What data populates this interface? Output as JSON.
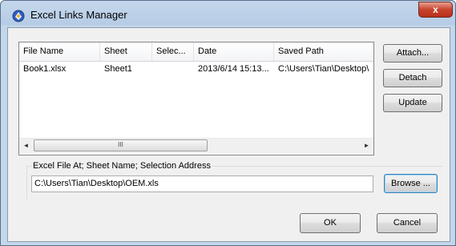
{
  "window": {
    "title": "Excel Links Manager",
    "close_glyph": "x"
  },
  "icons": {
    "app": "excel-links-app-icon",
    "close": "close-icon"
  },
  "list": {
    "columns": [
      "File Name",
      "Sheet",
      "Selec...",
      "Date",
      "Saved Path"
    ],
    "rows": [
      {
        "file_name": "Book1.xlsx",
        "sheet": "Sheet1",
        "selection": "",
        "date": "2013/6/14 15:13...",
        "saved_path": "C:\\Users\\Tian\\Desktop\\"
      }
    ],
    "scroll_left_glyph": "◄",
    "scroll_right_glyph": "►",
    "scroll_thumb_glyph": "III"
  },
  "buttons": {
    "attach": "Attach...",
    "detach": "Detach",
    "update": "Update",
    "browse": "Browse ...",
    "ok": "OK",
    "cancel": "Cancel"
  },
  "excel_file": {
    "label": "Excel File At; Sheet Name; Selection Address",
    "value": "C:\\Users\\Tian\\Desktop\\OEM.xls"
  },
  "colors": {
    "titlebar": "#b6cce6",
    "close_button": "#c7432d",
    "default_button_border": "#3c7fb1"
  }
}
